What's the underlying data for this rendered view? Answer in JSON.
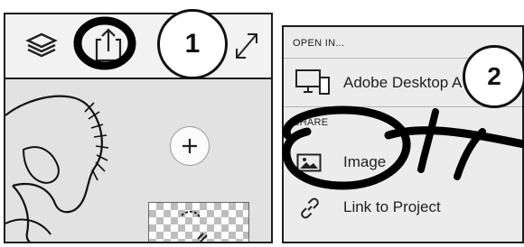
{
  "left_panel": {
    "toolbar_icons": [
      "layers-icon",
      "share-icon",
      "expand-icon"
    ]
  },
  "right_panel": {
    "open_in": {
      "section_label": "OPEN IN...",
      "items": [
        {
          "label": "Adobe Desktop A",
          "icon": "desktop-icon"
        }
      ]
    },
    "share": {
      "section_label": "SHARE",
      "items": [
        {
          "label": "Image",
          "icon": "image-icon"
        },
        {
          "label": "Link to Project",
          "icon": "link-icon"
        }
      ]
    }
  },
  "callouts": [
    {
      "number": "1",
      "target": "share-icon"
    },
    {
      "number": "2",
      "target": "image"
    }
  ]
}
